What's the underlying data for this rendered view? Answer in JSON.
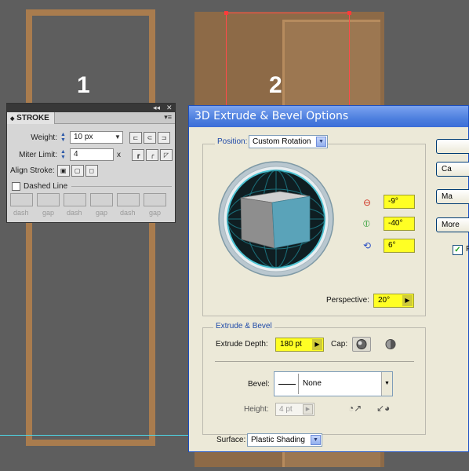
{
  "canvas": {
    "label_1": "1",
    "label_2": "2"
  },
  "stroke_panel": {
    "collapse_glyph": "◂◂",
    "close_glyph": "✕",
    "title": "STROKE",
    "menu_glyph": "▾≡",
    "weight_label": "Weight:",
    "weight_value": "10 px",
    "miter_label": "Miter Limit:",
    "miter_value": "4",
    "miter_x": "x",
    "align_label": "Align Stroke:",
    "dashed_label": "Dashed Line",
    "dash_labels": [
      "dash",
      "gap",
      "dash",
      "gap",
      "dash",
      "gap"
    ]
  },
  "dialog": {
    "title": "3D Extrude & Bevel Options",
    "position_label": "Position:",
    "position_value": "Custom Rotation",
    "x_rotation": "-9°",
    "y_rotation": "-40°",
    "z_rotation": "6°",
    "perspective_label": "Perspective:",
    "perspective_value": "20°",
    "extrude_group": "Extrude & Bevel",
    "extrude_label": "Extrude Depth:",
    "extrude_value": "180 pt",
    "cap_label": "Cap:",
    "bevel_label": "Bevel:",
    "bevel_value": "None",
    "height_label": "Height:",
    "height_value": "4 pt",
    "surface_label": "Surface:",
    "surface_value": "Plastic Shading",
    "buttons": {
      "ok": "",
      "cancel": "Ca",
      "map": "Ma",
      "more": "More"
    },
    "preview_partial": "P"
  },
  "colors": {
    "cube_front": "#8e8e8e",
    "cube_side": "#5aa3b9",
    "cube_top": "#d0d0d0",
    "highlight": "#ffff24",
    "frame": "#a97c4e"
  }
}
